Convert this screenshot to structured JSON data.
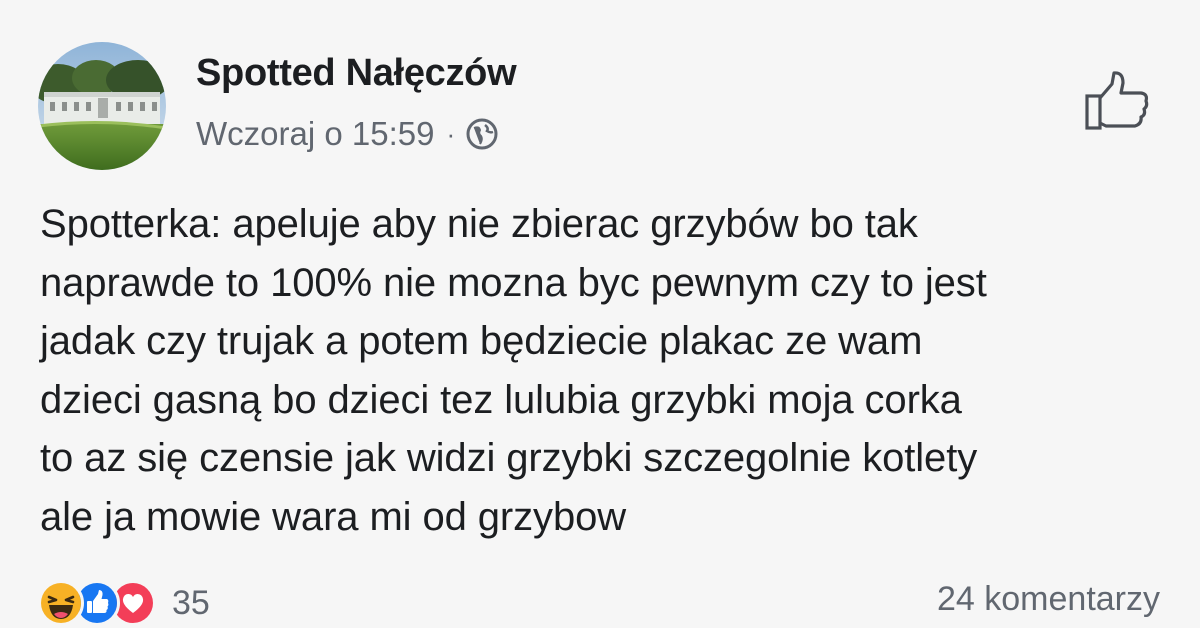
{
  "post": {
    "author": "Spotted Nałęczów",
    "timestamp": "Wczoraj o 15:59",
    "separator": "·",
    "privacy_icon": "globe-icon",
    "text_lines": [
      "Spotterka: apeluje aby nie zbierac grzybów bo tak",
      "naprawde to 100% nie mozna byc pewnym czy to jest",
      "jadak czy trujak a potem będziecie plakac ze wam",
      "dzieci gasną bo dzieci tez lulubia grzybki moja corka",
      "to az się czensie jak widzi grzybki szczegolnie kotlety",
      "ale ja mowie wara mi od grzybow"
    ]
  },
  "footer": {
    "reactions": [
      "haha",
      "like",
      "love"
    ],
    "reaction_count": "35",
    "comments": "24 komentarzy"
  },
  "colors": {
    "background": "#f6f6f6",
    "text": "#1c1e21",
    "secondary_text": "#616770",
    "like_blue": "#1877f2",
    "love_red": "#f33e58",
    "haha_yellow": "#f7b125"
  }
}
